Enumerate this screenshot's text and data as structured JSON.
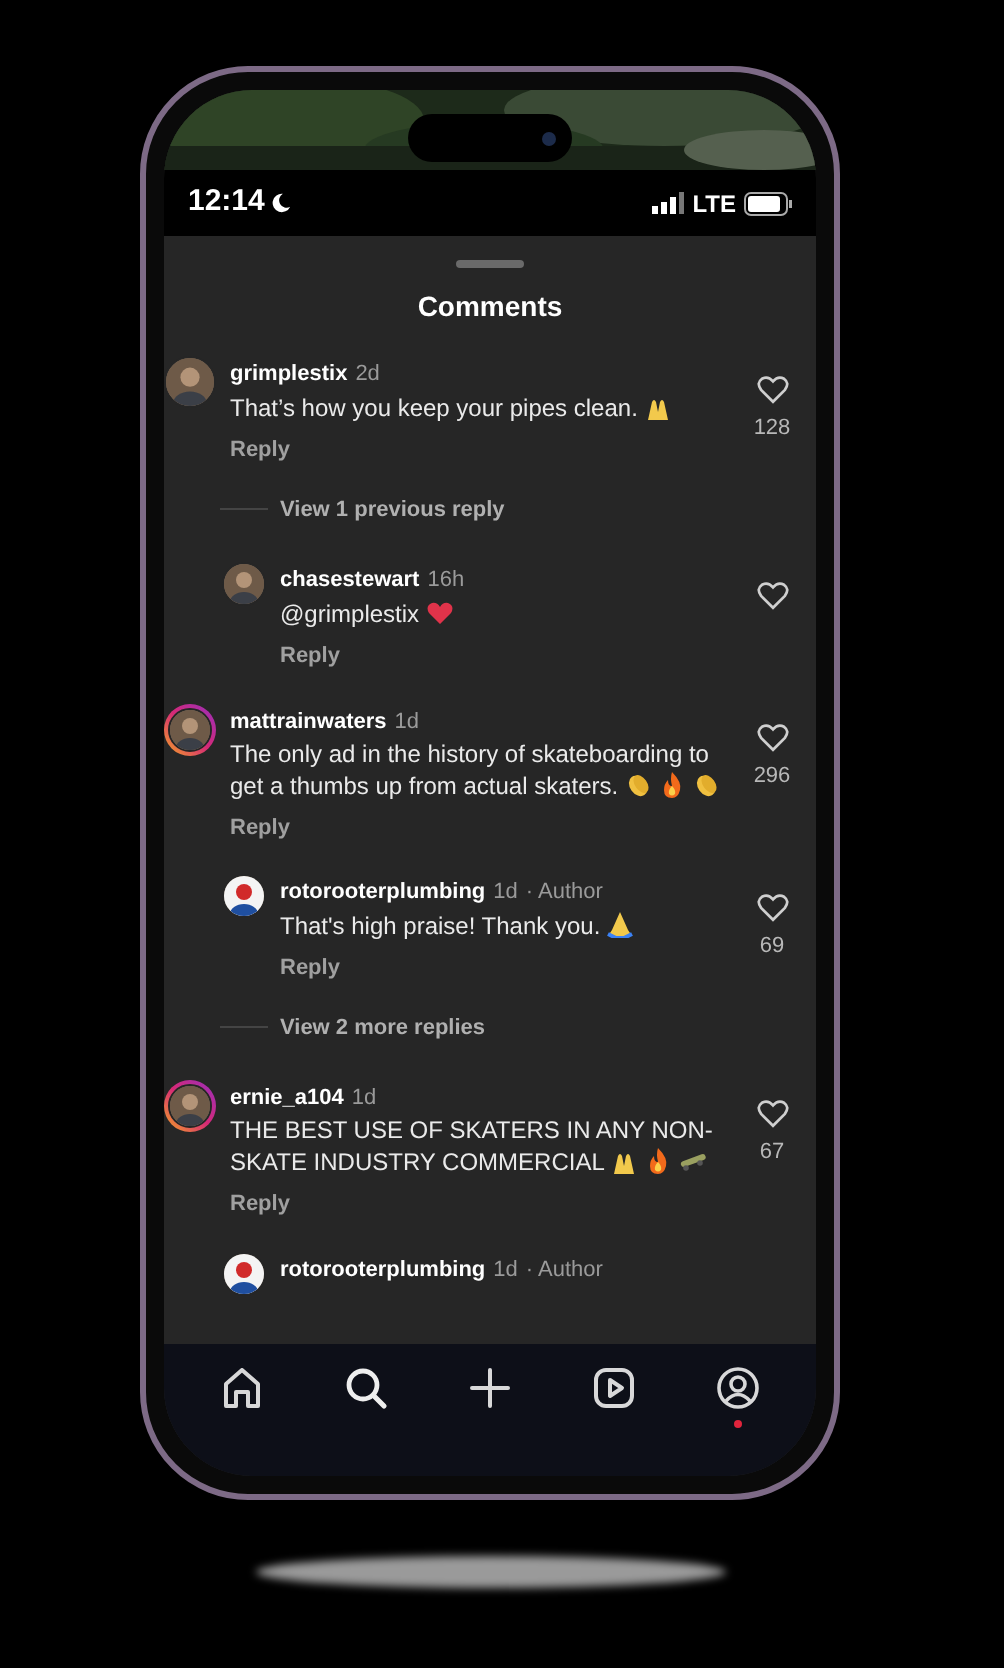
{
  "status_bar": {
    "time": "12:14",
    "network": "LTE"
  },
  "sheet": {
    "title": "Comments"
  },
  "items": [
    {
      "kind": "comment",
      "username": "grimplestix",
      "time": "2d",
      "text": "That’s how you keep your pipes clean.",
      "emoji": [
        {
          "kind": "hands"
        }
      ],
      "story_ring": false,
      "likes": "128",
      "reply": "Reply"
    },
    {
      "kind": "more",
      "label": "View 1 previous reply"
    },
    {
      "kind": "reply",
      "username": "chasestewart",
      "time": "16h",
      "text": "@grimplestix",
      "emoji": [
        {
          "kind": "heart"
        }
      ],
      "story_ring": false,
      "reply": "Reply"
    },
    {
      "kind": "comment",
      "username": "mattrainwaters",
      "time": "1d",
      "text": "The only ad in the history of skateboarding to get a thumbs up from actual skaters.",
      "emoji": [
        {
          "kind": "clap"
        },
        {
          "kind": "fire"
        },
        {
          "kind": "clap"
        }
      ],
      "story_ring": true,
      "likes": "296",
      "reply": "Reply"
    },
    {
      "kind": "reply",
      "username": "rotorooterplumbing",
      "time": "1d",
      "badge": "· Author",
      "text": "That's high praise! Thank you.",
      "emoji": [
        {
          "kind": "pray"
        }
      ],
      "story_ring": false,
      "likes": "69",
      "reply": "Reply"
    },
    {
      "kind": "more",
      "label": "View 2 more replies"
    },
    {
      "kind": "comment",
      "username": "ernie_a104",
      "time": "1d",
      "text": "THE BEST USE OF SKATERS IN ANY NON-SKATE INDUSTRY COMMERCIAL",
      "emoji": [
        {
          "kind": "hands"
        },
        {
          "kind": "fire"
        },
        {
          "kind": "skateboard"
        }
      ],
      "story_ring": true,
      "likes": "67",
      "reply": "Reply"
    },
    {
      "kind": "reply",
      "username": "rotorooterplumbing",
      "time": "1d",
      "badge": "· Author",
      "story_ring": false
    }
  ],
  "nav": [
    {
      "kind": "home",
      "selected": false
    },
    {
      "kind": "search",
      "selected": true
    },
    {
      "kind": "create",
      "selected": false
    },
    {
      "kind": "reels",
      "selected": false
    },
    {
      "kind": "profile",
      "selected": false,
      "notification": true
    }
  ]
}
